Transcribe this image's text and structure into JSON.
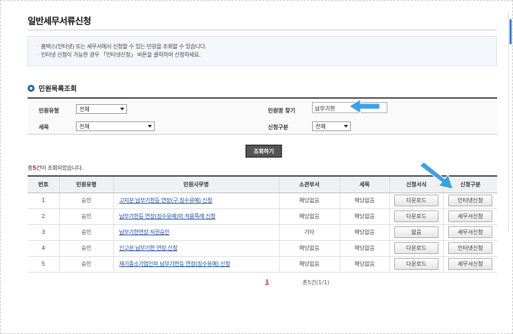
{
  "page": {
    "title": "일반세무서류신청"
  },
  "info": {
    "lines": [
      "홈택스(인터넷) 또는 세무서에서 신청할 수 있는 민원을 조회할 수 있습니다.",
      "인터넷 신청이 가능한 경우  「인터넷신청」 버튼을 클릭하여 신청하세요."
    ]
  },
  "section": {
    "title": "민원목록조회"
  },
  "search": {
    "type_label": "민원유형",
    "type_value": "전체",
    "tax_label": "세목",
    "tax_value": "전체",
    "name_label": "민원명 찾기",
    "name_value": "납부기한",
    "apply_label": "신청구분",
    "apply_value": "전체",
    "button": "조회하기"
  },
  "result": {
    "prefix": "총",
    "count": "5",
    "suffix": "건이 조회되었습니다."
  },
  "table": {
    "headers": [
      "번호",
      "민원유형",
      "민원사무명",
      "소관부서",
      "세목",
      "신청서식",
      "신청구분"
    ],
    "rows": [
      {
        "no": "1",
        "type": "승인",
        "name": "고지분 납부기한등 연장(구.징수유예) 신청",
        "dept": "해당없음",
        "tax": "해당없음",
        "form": "다운로드",
        "apply": "인터넷신청"
      },
      {
        "no": "2",
        "type": "승인",
        "name": "납부기한등 연장(징수유예)의 적용특례 신청",
        "dept": "해당없음",
        "tax": "해당없음",
        "form": "다운로드",
        "apply": "세무서신청"
      },
      {
        "no": "3",
        "type": "승인",
        "name": "납부기한연장 직권승인",
        "dept": "기타",
        "tax": "해당없음",
        "form": "없음",
        "apply": "세무서신청"
      },
      {
        "no": "4",
        "type": "승인",
        "name": "신고분 납부기한 연장 신청",
        "dept": "해당없음",
        "tax": "해당없음",
        "form": "다운로드",
        "apply": "인터넷신청"
      },
      {
        "no": "5",
        "type": "승인",
        "name": "재기중소기업인의 납부기한등 연장(징수유예) 신청",
        "dept": "해당없음",
        "tax": "해당없음",
        "form": "다운로드",
        "apply": "세무서신청"
      }
    ]
  },
  "pagination": {
    "current": "1",
    "summary": "총5건(1/1)"
  },
  "colors": {
    "arrow": "#3aa0e8",
    "accent": "#1f5fa8",
    "count": "#d31f1f"
  }
}
